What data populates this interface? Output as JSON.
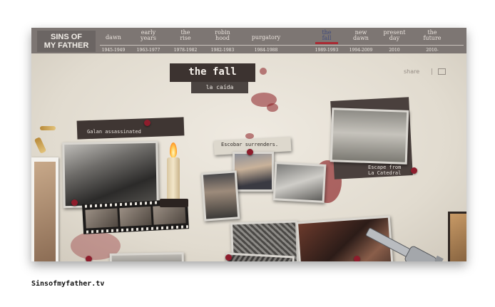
{
  "site": {
    "brand": "SINS OF\nMY FATHER",
    "footer": "Sinsofmyfather.tv"
  },
  "nav": {
    "tabs": [
      {
        "name": "dawn",
        "years": "1945-1949",
        "active": false
      },
      {
        "name": "early\nyears",
        "years": "1963-1977",
        "active": false
      },
      {
        "name": "the\nrise",
        "years": "1978-1982",
        "active": false
      },
      {
        "name": "robin\nhood",
        "years": "1982-1983",
        "active": false
      },
      {
        "name": "purgatory",
        "years": "1984-1988",
        "active": false
      },
      {
        "name": "the\nfall",
        "years": "1989-1993",
        "active": true
      },
      {
        "name": "new\ndawn",
        "years": "1994-2009",
        "active": false
      },
      {
        "name": "present\nday",
        "years": "2010",
        "active": false
      },
      {
        "name": "the\nfuture",
        "years": "2010-",
        "active": false
      }
    ]
  },
  "chapter": {
    "title": "the fall",
    "subtitle": "la caída"
  },
  "controls": {
    "share_label": "share"
  },
  "captions": {
    "galan": "Galan assassinated",
    "escobar": "Escobar surrenders.",
    "escape": "Escape from\nLa Catedral"
  },
  "colors": {
    "accent": "#a92a33",
    "active_tab_text": "#3e4a7c",
    "nav_bg": "#7d7673"
  }
}
